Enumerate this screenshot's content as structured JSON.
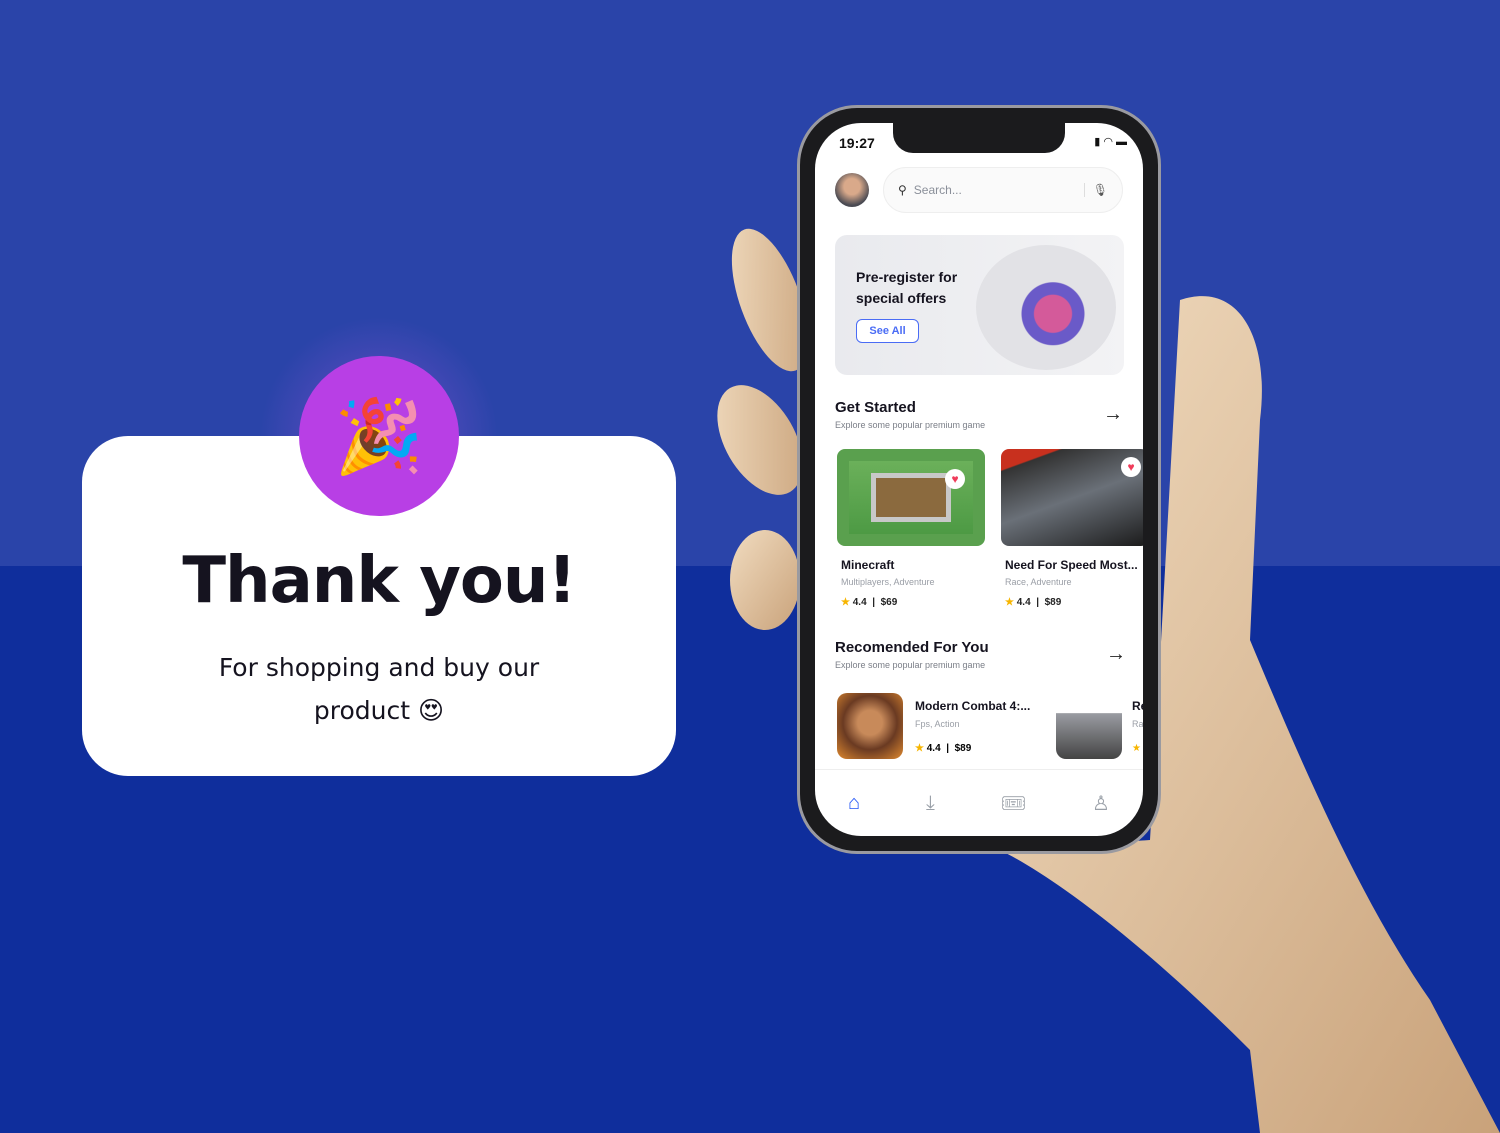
{
  "card": {
    "emoji": "🎉",
    "title": "Thank you!",
    "subtitle": "For shopping and buy our product 😍"
  },
  "phone": {
    "status": {
      "time": "19:27"
    },
    "search": {
      "placeholder": "Search..."
    },
    "promo": {
      "title": "Pre-register for special offers",
      "button": "See All"
    },
    "get_started": {
      "title": "Get Started",
      "subtitle": "Explore some popular premium game",
      "games": [
        {
          "title": "Minecraft",
          "genre": "Multiplayers, Adventure",
          "rating": "4.4",
          "price": "$69"
        },
        {
          "title": "Need For Speed Most...",
          "genre": "Race, Adventure",
          "rating": "4.4",
          "price": "$89"
        }
      ]
    },
    "recommended": {
      "title": "Recomended For You",
      "subtitle": "Explore some popular premium game",
      "games": [
        {
          "title": "Modern Combat 4:...",
          "genre": "Fps, Action",
          "rating": "4.4",
          "price": "$89"
        },
        {
          "title": "Re",
          "genre": "Ra",
          "rating": "",
          "price": ""
        }
      ]
    },
    "nav": [
      "home-icon",
      "downloads-icon",
      "ticket-icon",
      "profile-icon"
    ]
  },
  "colors": {
    "accent": "#2356f6",
    "badge": "#b83fe5",
    "bg_top": "#2a44a9",
    "bg_bottom": "#0f2e9c"
  }
}
